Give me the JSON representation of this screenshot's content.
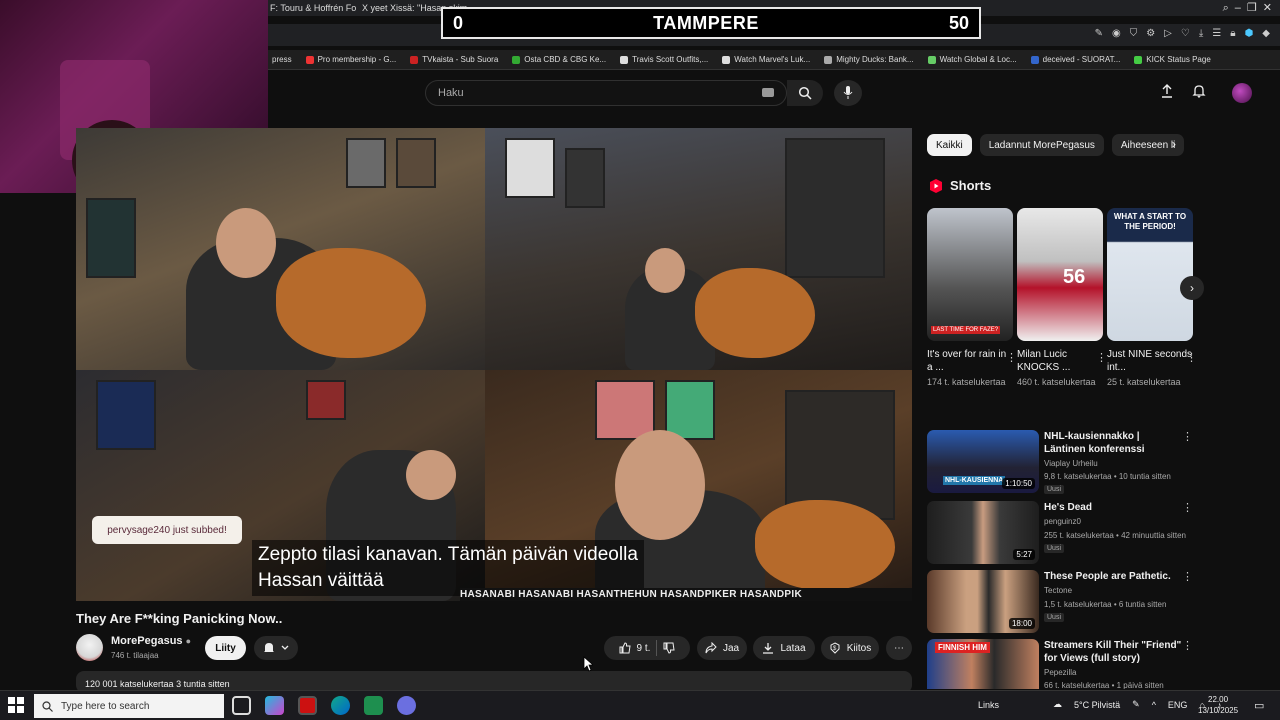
{
  "browser": {
    "tabs": [
      {
        "label": "F: Touru & Hoffrén For"
      },
      {
        "label": "X yeet Xissä: \"Hasan skim"
      }
    ],
    "bookmarks": [
      {
        "label": "press",
        "color": "#888"
      },
      {
        "label": "Pro membership - G...",
        "color": "#e33"
      },
      {
        "label": "TVkaista - Sub Suora",
        "color": "#c22"
      },
      {
        "label": "Osta CBD & CBG Ke...",
        "color": "#3a3"
      },
      {
        "label": "Travis Scott Outfits,...",
        "color": "#ddd"
      },
      {
        "label": "Watch Marvel's Luk...",
        "color": "#ddd"
      },
      {
        "label": "Mighty Ducks: Bank...",
        "color": "#aaa"
      },
      {
        "label": "Watch Global & Loc...",
        "color": "#6c6"
      },
      {
        "label": "deceived - SUORAT...",
        "color": "#36c"
      },
      {
        "label": "KICK Status Page",
        "color": "#4c4"
      }
    ]
  },
  "scoreboard": {
    "left_score": "0",
    "team": "TAMMPERE",
    "right_score": "50"
  },
  "youtube": {
    "search_placeholder": "Haku"
  },
  "video": {
    "sub_alert": "pervysage240 just subbed!",
    "caption_line1": "Zeppto tilasi kanavan.  Tämän päivän videolla",
    "caption_line2": "Hassan väittää",
    "social_banner": "HASANABI  HASANABI  HASANTHEHUN  HASANDPIKER  HASANDPIK",
    "title": "They Are F**king Panicking Now..",
    "channel_name": "MorePegasus",
    "channel_subs": "746 t. tilaajaa",
    "join_label": "Liity",
    "like_count": "9 t.",
    "share_label": "Jaa",
    "download_label": "Lataa",
    "thanks_label": "Kiitos",
    "description": "120 001 katselukertaa  3 tuntia sitten"
  },
  "sidebar": {
    "chips": [
      "Kaikki",
      "Ladannut MorePegasus",
      "Aiheeseen li"
    ],
    "shorts_heading": "Shorts",
    "shorts": [
      {
        "title": "It's over for rain in a ...",
        "views": "174 t. katselukertaa",
        "thumb_text": "LAST TIME FOR FAZE?"
      },
      {
        "title": "Milan Lucic KNOCKS ...",
        "views": "460 t. katselukertaa",
        "thumb_text": "56"
      },
      {
        "title": "Just NINE seconds int...",
        "views": "25 t. katselukertaa",
        "thumb_text": "WHAT A START TO THE PERIOD!"
      }
    ],
    "recommendations": [
      {
        "title": "NHL-kausiennakko | Läntinen konferenssi",
        "channel": "Viaplay Urheilu",
        "meta": "9,8 t. katselukertaa • 10 tuntia sitten",
        "badge": "Uusi",
        "duration": "1:10:50",
        "thumb_text": "NHL-KAUSIENNA"
      },
      {
        "title": "He's Dead",
        "channel": "penguinz0",
        "meta": "255 t. katselukertaa • 42 minuuttia sitten",
        "badge": "Uusi",
        "duration": "5:27",
        "thumb_text": ""
      },
      {
        "title": "These People are Pathetic.",
        "channel": "Tectone",
        "meta": "1,5 t. katselukertaa • 6 tuntia sitten",
        "badge": "Uusi",
        "duration": "18:00",
        "thumb_text": ""
      },
      {
        "title": "Streamers Kill Their \"Friend\" for Views (full story)",
        "channel": "Pepezilla",
        "meta": "66 t. katselukertaa • 1 päivä sitten",
        "badge": "",
        "duration": "",
        "thumb_text": "FINNISH HIM"
      }
    ]
  },
  "taskbar": {
    "search_placeholder": "Type here to search",
    "links": "Links",
    "weather": "5°C Pilvistä",
    "language": "ENG",
    "time": "22.00",
    "date": "13/10/2025"
  }
}
